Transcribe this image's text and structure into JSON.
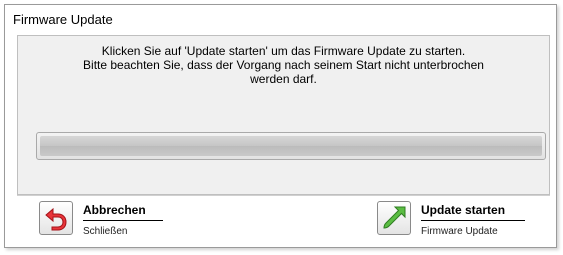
{
  "dialog": {
    "title": "Firmware Update"
  },
  "message": {
    "line1": "Klicken Sie auf 'Update starten' um das Firmware Update zu starten.",
    "line2": "Bitte beachten Sie, dass der Vorgang nach seinem Start nicht unterbrochen",
    "line3": "werden darf."
  },
  "progress": {
    "value": 1.0
  },
  "actions": {
    "cancel": {
      "label": "Abbrechen",
      "sublabel": "Schließen",
      "icon": "back-arrow-icon",
      "color": "#e8343a"
    },
    "start": {
      "label": "Update starten",
      "sublabel": "Firmware Update",
      "icon": "up-right-arrow-icon",
      "color": "#4fae3a"
    }
  }
}
